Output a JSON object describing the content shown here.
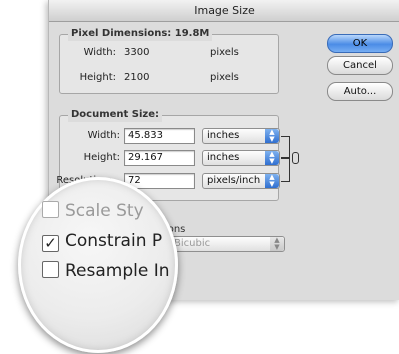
{
  "dialog": {
    "title": "Image Size",
    "pixel_dimensions": {
      "legend": "Pixel Dimensions: 19.8M",
      "width_label": "Width:",
      "width_value": "3300",
      "width_unit": "pixels",
      "height_label": "Height:",
      "height_value": "2100",
      "height_unit": "pixels"
    },
    "document_size": {
      "legend": "Document Size:",
      "width_label": "Width:",
      "width_value": "45.833",
      "width_unit": "inches",
      "height_label": "Height:",
      "height_value": "29.167",
      "height_unit": "inches",
      "resolution_label": "Resolution:",
      "resolution_value": "72",
      "resolution_unit": "pixels/inch"
    },
    "buttons": {
      "ok": "OK",
      "cancel": "Cancel",
      "auto": "Auto..."
    },
    "options": {
      "partial_label": "tions",
      "resample_method": "Bicubic"
    }
  },
  "lens": {
    "scale_styles": "Scale Sty",
    "constrain": "Constrain P",
    "resample": "Resample In"
  },
  "colors": {
    "accent": "#4b8ce6"
  }
}
